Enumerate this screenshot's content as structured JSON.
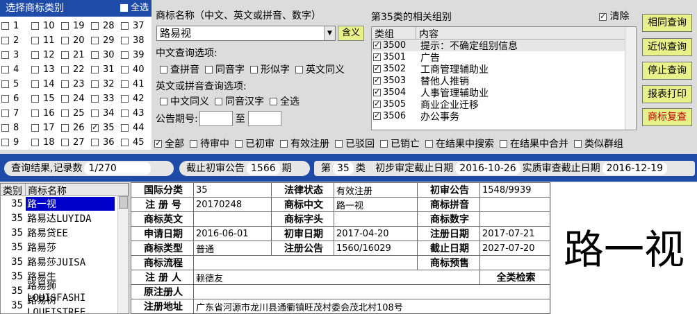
{
  "category_panel": {
    "title": "选择商标类别",
    "select_all_label": "全选",
    "columns": [
      [
        "1",
        "2",
        "3",
        "4",
        "5",
        "6",
        "7",
        "8",
        "9"
      ],
      [
        "10",
        "11",
        "12",
        "13",
        "14",
        "15",
        "16",
        "17",
        "18"
      ],
      [
        "19",
        "20",
        "21",
        "22",
        "23",
        "24",
        "25",
        "26",
        "27"
      ],
      [
        "28",
        "29",
        "30",
        "31",
        "32",
        "33",
        "34",
        "35",
        "36"
      ],
      [
        "37",
        "38",
        "39",
        "40",
        "41",
        "42",
        "43",
        "44",
        "45"
      ]
    ],
    "checked": [
      "35"
    ]
  },
  "name_search": {
    "label": "商标名称（中文、英文或拼音、数字）",
    "value": "路易视",
    "meaning_button": "含义",
    "cn_options_label": "中文查询选项:",
    "cn_options": [
      "查拼音",
      "同音字",
      "形似字",
      "英文同义"
    ],
    "en_options_label": "英文或拼音查询选项:",
    "en_options": [
      "中文同义",
      "同音汉字",
      "全选"
    ],
    "period_label": "公告期号:",
    "period_to": "至"
  },
  "group_panel": {
    "title": "第35类的相关组别",
    "clear_label": "清除",
    "col_group": "类组",
    "col_content": "内容",
    "rows": [
      {
        "code": "3500",
        "text": "提示：不确定组别信息"
      },
      {
        "code": "3501",
        "text": "广告"
      },
      {
        "code": "3502",
        "text": "工商管理辅助业"
      },
      {
        "code": "3503",
        "text": "替他人推销"
      },
      {
        "code": "3504",
        "text": "人事管理辅助业"
      },
      {
        "code": "3505",
        "text": "商业企业迁移"
      },
      {
        "code": "3506",
        "text": "办公事务"
      }
    ]
  },
  "actions": {
    "same_query": "相同查询",
    "similar_query": "近似查询",
    "stop_query": "停止查询",
    "print_report": "报表打印",
    "recheck": "商标复查"
  },
  "filters": [
    {
      "label": "全部",
      "checked": true
    },
    {
      "label": "待审中",
      "checked": false
    },
    {
      "label": "已初审",
      "checked": false
    },
    {
      "label": "有效注册",
      "checked": false
    },
    {
      "label": "已驳回",
      "checked": false
    },
    {
      "label": "已销亡",
      "checked": false
    },
    {
      "label": "在结果中搜索",
      "checked": false
    },
    {
      "label": "在结果中合并",
      "checked": false
    },
    {
      "label": "类似群组",
      "checked": false
    }
  ],
  "status_bar": {
    "result_label": "查询结果,记录数",
    "result_count": "1/270",
    "cutoff_label": "截止初审公告",
    "cutoff_value": "1566",
    "cutoff_unit": "期",
    "class_prefix": "第",
    "class_value": "35",
    "class_suffix": "类",
    "prelim_label": "初步审定截止日期",
    "prelim_date": "2016-10-26",
    "substantive_label": "实质审查截止日期",
    "substantive_date": "2016-12-19"
  },
  "result_list": {
    "col_class": "类别",
    "col_name": "商标名称",
    "rows": [
      {
        "cls": "35",
        "name": "路一视"
      },
      {
        "cls": "35",
        "name": "路易达LUYIDA"
      },
      {
        "cls": "35",
        "name": "路易贷EE"
      },
      {
        "cls": "35",
        "name": "路易莎"
      },
      {
        "cls": "35",
        "name": "路易莎JUISA"
      },
      {
        "cls": "35",
        "name": "路易生"
      },
      {
        "cls": "35",
        "name": "路易狮LOUISFASHI"
      },
      {
        "cls": "35",
        "name": "路易树LOUEISTREE"
      }
    ]
  },
  "detail": {
    "intl_class_k": "国际分类",
    "intl_class": "35",
    "legal_k": "法律状态",
    "legal": "有效注册",
    "prelim_pub_k": "初审公告",
    "prelim_pub": "1548/9939",
    "reg_no_k": "注 册 号",
    "reg_no": "20170248",
    "cn_name_k": "商标中文",
    "cn_name": "路一视",
    "pinyin_k": "商标拼音",
    "pinyin": "",
    "en_k": "商标英文",
    "en": "",
    "head_k": "商标字头",
    "head": "",
    "digit_k": "商标数字",
    "digit": "",
    "apply_date_k": "申请日期",
    "apply_date": "2016-06-01",
    "prelim_date_k": "初审日期",
    "prelim_date": "2017-04-20",
    "reg_date_k": "注册日期",
    "reg_date": "2017-07-21",
    "type_k": "商标类型",
    "type": "普通",
    "reg_pub_k": "注册公告",
    "reg_pub": "1560/16029",
    "expire_k": "截止日期",
    "expire": "2027-07-20",
    "flow_k": "商标流程",
    "flow": "",
    "presale_k": "商标预售",
    "presale": "",
    "registrant_k": "注 册 人",
    "registrant": "赖德友",
    "all_class_search": "全类检索",
    "orig_registrant_k": "原注册人",
    "orig_registrant": "",
    "address_k": "注册地址",
    "address": "广东省河源市龙川县通衢镇旺茂村委会茂北村108号"
  },
  "preview": {
    "text": "路一视"
  }
}
